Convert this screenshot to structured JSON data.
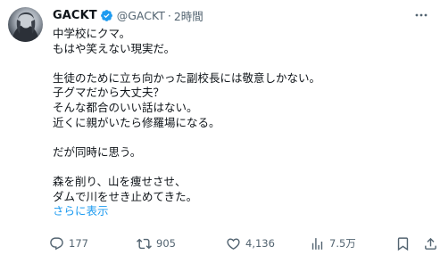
{
  "tweet": {
    "author": {
      "display_name": "GACKT",
      "handle": "@GACKT",
      "separator": "·",
      "time": "2時間"
    },
    "lines": [
      "中学校にクマ。",
      "もはや笑えない現実だ。",
      "",
      "生徒のために立ち向かった副校長には敬意しかない。",
      "子グマだから大丈夫？",
      "そんな都合のいい話はない。",
      "近くに親がいたら修羅場になる。",
      "",
      "だが同時に思う。",
      "",
      "森を削り、山を痩せさせ、",
      "ダムで川をせき止めてきた。"
    ],
    "show_more": "さらに表示",
    "stats": {
      "replies": "177",
      "reposts": "905",
      "likes": "4,136",
      "views": "7.5万"
    }
  },
  "icons": [
    "verified-icon",
    "more-icon",
    "reply-icon",
    "repost-icon",
    "like-icon",
    "views-icon",
    "bookmark-icon",
    "share-icon"
  ],
  "colors": {
    "text": "#0f1419",
    "secondary": "#536471",
    "link": "#1d9bf0",
    "verified": "#1d9bf0"
  }
}
